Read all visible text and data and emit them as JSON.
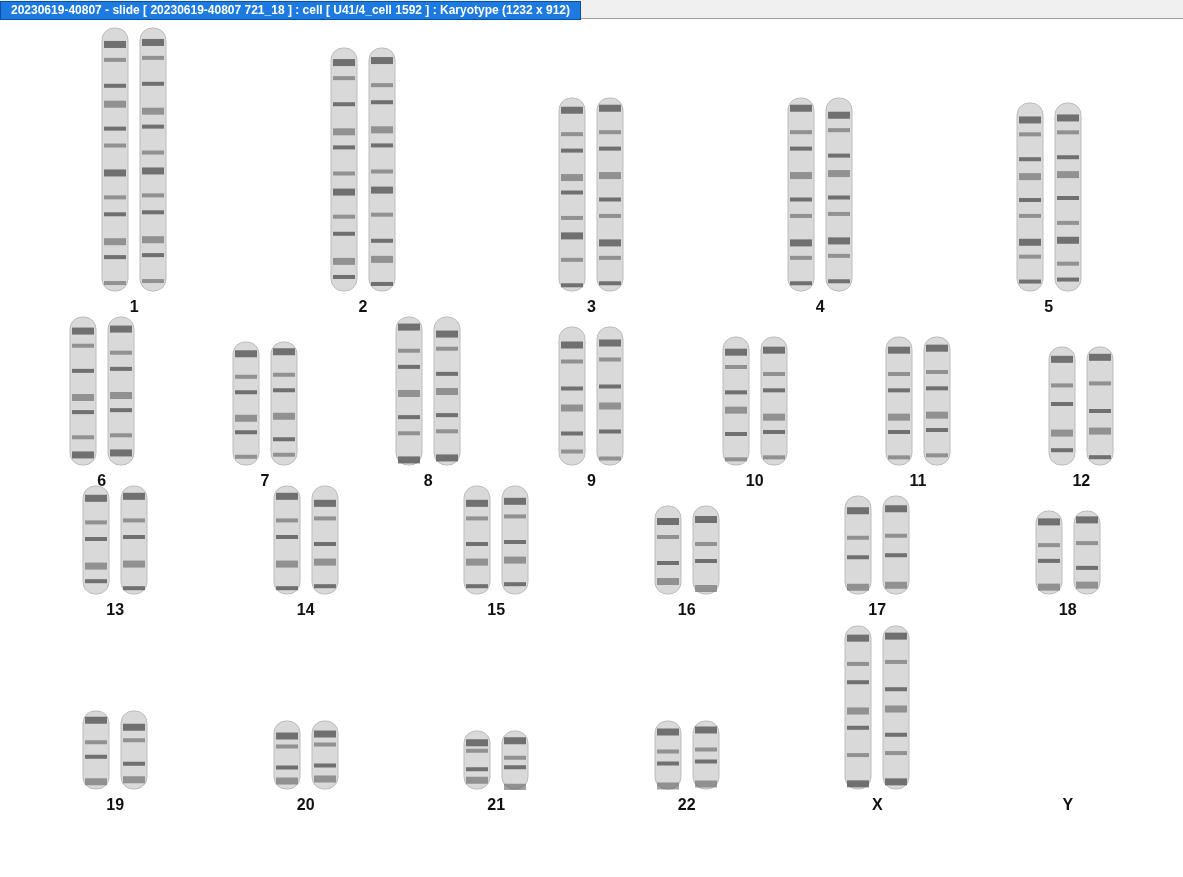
{
  "window": {
    "title": "20230619-40807 - slide [ 20230619-40807 721_18 ] : cell [ U41/4_cell 1592 ] : Karyotype  (1232 x 912)"
  },
  "karyotype": {
    "rows": [
      {
        "groups": [
          {
            "label": "1",
            "kind": "pair"
          },
          {
            "label": "2",
            "kind": "pair"
          },
          {
            "label": "3",
            "kind": "pair"
          },
          {
            "label": "4",
            "kind": "pair"
          },
          {
            "label": "5",
            "kind": "pair"
          }
        ]
      },
      {
        "groups": [
          {
            "label": "6",
            "kind": "pair"
          },
          {
            "label": "7",
            "kind": "pair"
          },
          {
            "label": "8",
            "kind": "pair"
          },
          {
            "label": "9",
            "kind": "pair"
          },
          {
            "label": "10",
            "kind": "pair"
          },
          {
            "label": "11",
            "kind": "pair"
          },
          {
            "label": "12",
            "kind": "pair"
          }
        ]
      },
      {
        "groups": [
          {
            "label": "13",
            "kind": "pair"
          },
          {
            "label": "14",
            "kind": "pair"
          },
          {
            "label": "15",
            "kind": "pair"
          },
          {
            "label": "16",
            "kind": "pair"
          },
          {
            "label": "17",
            "kind": "pair"
          },
          {
            "label": "18",
            "kind": "pair"
          }
        ]
      },
      {
        "groups": [
          {
            "label": "19",
            "kind": "pair"
          },
          {
            "label": "20",
            "kind": "pair"
          },
          {
            "label": "21",
            "kind": "pair"
          },
          {
            "label": "22",
            "kind": "pair"
          },
          {
            "label": "X",
            "kind": "pair"
          },
          {
            "label": "Y",
            "kind": "empty"
          }
        ]
      }
    ]
  }
}
